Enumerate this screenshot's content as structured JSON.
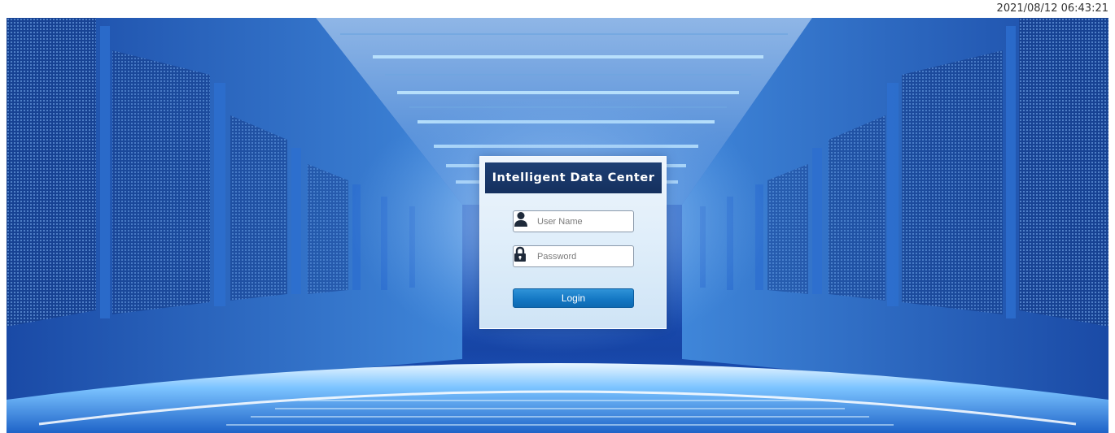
{
  "header": {
    "datetime": "2021/08/12 06:43:21"
  },
  "login": {
    "title": "Intelligent Data Center",
    "username_placeholder": "User Name",
    "username_value": "",
    "password_placeholder": "Password",
    "password_value": "",
    "login_label": "Login",
    "username_icon": "user-icon",
    "password_icon": "lock-icon"
  },
  "colors": {
    "background": "#1f5bc4",
    "title_bar": "#15305e",
    "login_button": "#1478c4"
  }
}
